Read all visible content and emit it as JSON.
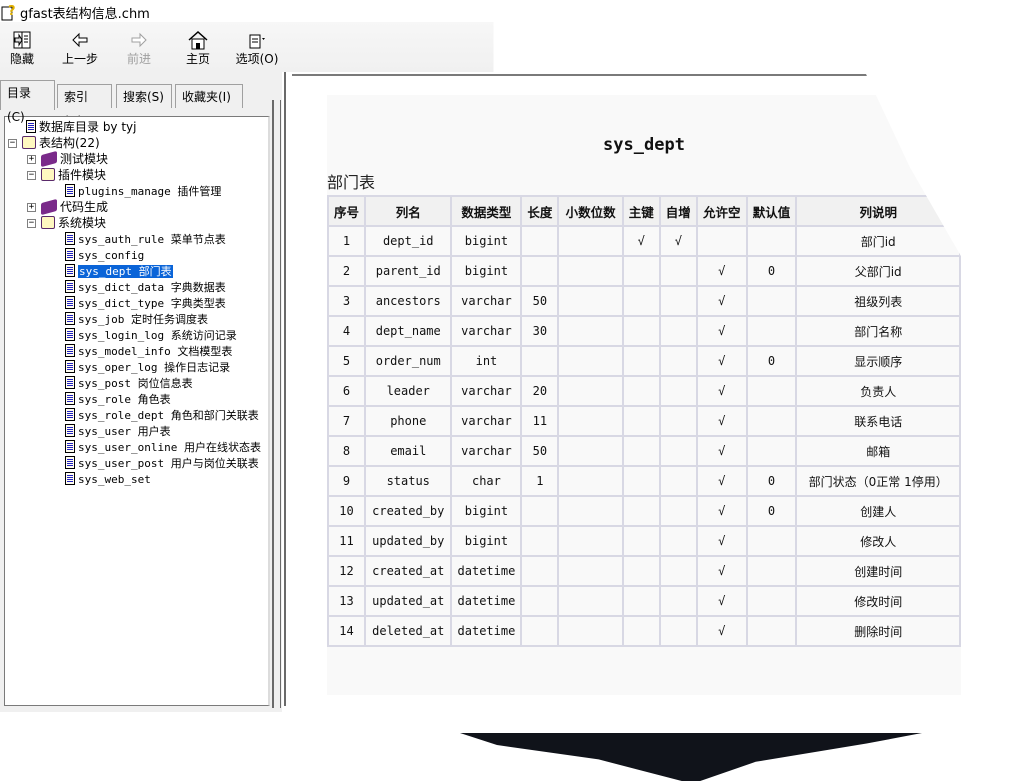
{
  "window": {
    "title": "gfast表结构信息.chm"
  },
  "toolbar": {
    "hide": "隐藏",
    "back": "上一步",
    "forward": "前进",
    "home": "主页",
    "options": "选项(O)"
  },
  "tabs": [
    {
      "label": "目录(C)",
      "active": true
    },
    {
      "label": "索引(N)",
      "active": false
    },
    {
      "label": "搜索(S)",
      "active": false
    },
    {
      "label": "收藏夹(I)",
      "active": false
    }
  ],
  "tree": [
    {
      "label": "数据库目录  by tyj",
      "type": "page",
      "level": 1
    },
    {
      "label": "表结构(22)",
      "type": "book-open",
      "level": 0,
      "expanded": true
    },
    {
      "label": "测试模块",
      "type": "book-closed",
      "level": 1,
      "expanded": false
    },
    {
      "label": "插件模块",
      "type": "book-open",
      "level": 1,
      "expanded": true
    },
    {
      "label": "plugins_manage 插件管理",
      "type": "page",
      "level": 2
    },
    {
      "label": "代码生成",
      "type": "book-closed",
      "level": 1,
      "expanded": false
    },
    {
      "label": "系统模块",
      "type": "book-open",
      "level": 1,
      "expanded": true
    },
    {
      "label": "sys_auth_rule 菜单节点表",
      "type": "page",
      "level": 2
    },
    {
      "label": "sys_config",
      "type": "page",
      "level": 2
    },
    {
      "label": "sys_dept 部门表",
      "type": "page",
      "level": 2,
      "selected": true
    },
    {
      "label": "sys_dict_data 字典数据表",
      "type": "page",
      "level": 2
    },
    {
      "label": "sys_dict_type 字典类型表",
      "type": "page",
      "level": 2
    },
    {
      "label": "sys_job 定时任务调度表",
      "type": "page",
      "level": 2
    },
    {
      "label": "sys_login_log 系统访问记录",
      "type": "page",
      "level": 2
    },
    {
      "label": "sys_model_info 文档模型表",
      "type": "page",
      "level": 2
    },
    {
      "label": "sys_oper_log 操作日志记录",
      "type": "page",
      "level": 2
    },
    {
      "label": "sys_post 岗位信息表",
      "type": "page",
      "level": 2
    },
    {
      "label": "sys_role 角色表",
      "type": "page",
      "level": 2
    },
    {
      "label": "sys_role_dept 角色和部门关联表",
      "type": "page",
      "level": 2
    },
    {
      "label": "sys_user 用户表",
      "type": "page",
      "level": 2
    },
    {
      "label": "sys_user_online 用户在线状态表",
      "type": "page",
      "level": 2
    },
    {
      "label": "sys_user_post 用户与岗位关联表",
      "type": "page",
      "level": 2
    },
    {
      "label": "sys_web_set",
      "type": "page",
      "level": 2
    }
  ],
  "content": {
    "table_name": "sys_dept",
    "table_comment": "部门表",
    "headers": [
      "序号",
      "列名",
      "数据类型",
      "长度",
      "小数位数",
      "主键",
      "自增",
      "允许空",
      "默认值",
      "列说明"
    ],
    "rows": [
      [
        "1",
        "dept_id",
        "bigint",
        "",
        "",
        "√",
        "√",
        "",
        "",
        "部门id"
      ],
      [
        "2",
        "parent_id",
        "bigint",
        "",
        "",
        "",
        "",
        "√",
        "0",
        "父部门id"
      ],
      [
        "3",
        "ancestors",
        "varchar",
        "50",
        "",
        "",
        "",
        "√",
        "",
        "祖级列表"
      ],
      [
        "4",
        "dept_name",
        "varchar",
        "30",
        "",
        "",
        "",
        "√",
        "",
        "部门名称"
      ],
      [
        "5",
        "order_num",
        "int",
        "",
        "",
        "",
        "",
        "√",
        "0",
        "显示顺序"
      ],
      [
        "6",
        "leader",
        "varchar",
        "20",
        "",
        "",
        "",
        "√",
        "",
        "负责人"
      ],
      [
        "7",
        "phone",
        "varchar",
        "11",
        "",
        "",
        "",
        "√",
        "",
        "联系电话"
      ],
      [
        "8",
        "email",
        "varchar",
        "50",
        "",
        "",
        "",
        "√",
        "",
        "邮箱"
      ],
      [
        "9",
        "status",
        "char",
        "1",
        "",
        "",
        "",
        "√",
        "0",
        "部门状态（0正常 1停用）"
      ],
      [
        "10",
        "created_by",
        "bigint",
        "",
        "",
        "",
        "",
        "√",
        "0",
        "创建人"
      ],
      [
        "11",
        "updated_by",
        "bigint",
        "",
        "",
        "",
        "",
        "√",
        "",
        "修改人"
      ],
      [
        "12",
        "created_at",
        "datetime",
        "",
        "",
        "",
        "",
        "√",
        "",
        "创建时间"
      ],
      [
        "13",
        "updated_at",
        "datetime",
        "",
        "",
        "",
        "",
        "√",
        "",
        "修改时间"
      ],
      [
        "14",
        "deleted_at",
        "datetime",
        "",
        "",
        "",
        "",
        "√",
        "",
        "删除时间"
      ]
    ]
  },
  "colors": {
    "selection": "#0a64d8",
    "table_border": "#d8d8e4",
    "header_bg": "#f1f1f1"
  }
}
